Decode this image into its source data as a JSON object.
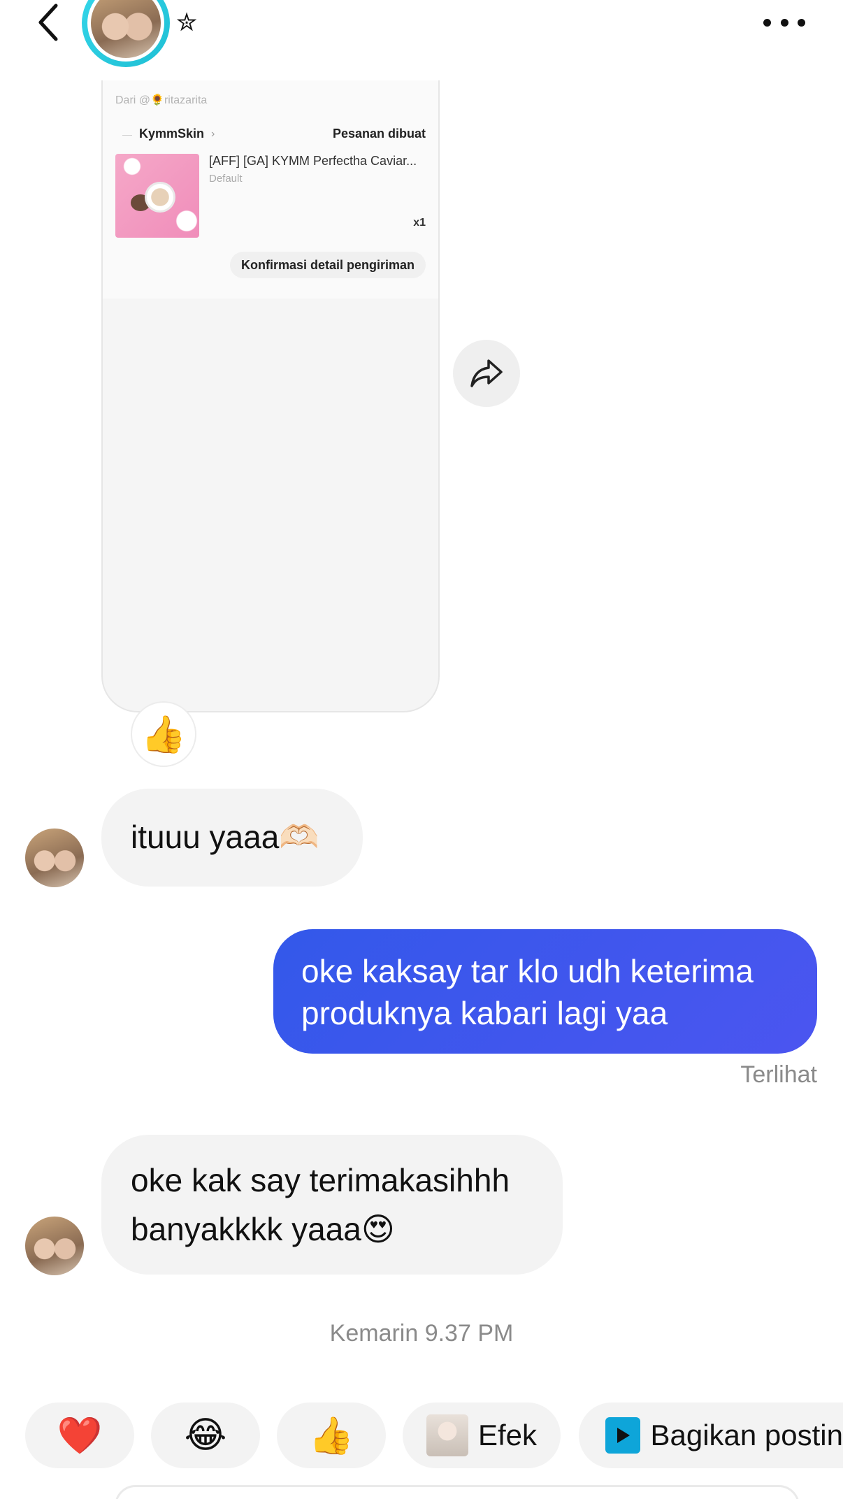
{
  "header": {
    "back_icon": "chevron-left-icon",
    "star_glyph": "✮",
    "more_icon": "more-horizontal-icon"
  },
  "shared_order": {
    "from_label": "Dari @🌻ritazarita",
    "shop_name": "KymmSkin",
    "status": "Pesanan dibuat",
    "product_name": "[AFF] [GA] KYMM Perfectha Caviar...",
    "variant": "Default",
    "quantity": "x1",
    "confirm_label": "Konfirmasi detail pengiriman"
  },
  "reaction": {
    "emoji": "👍"
  },
  "messages": {
    "msg1": "ituuu yaaa🫶🏻",
    "msg2_line1": "oke kaksay tar klo udh keterima",
    "msg2_line2": "produknya kabari lagi yaa",
    "seen_status": "Terlihat",
    "msg3_line1": "oke kak say terimakasihhh",
    "msg3_line2": "banyakkkk yaaa😍",
    "timestamp": "Kemarin 9.37 PM"
  },
  "quick_bar": {
    "heart": "❤️",
    "laugh": "😂",
    "thumbs": "👍",
    "efek_label": "Efek",
    "share_label": "Bagikan postin"
  },
  "colors": {
    "accent_ring": "#35d7ea",
    "outgoing_bubble": "#3358ea",
    "incoming_bubble": "#f3f3f3"
  }
}
